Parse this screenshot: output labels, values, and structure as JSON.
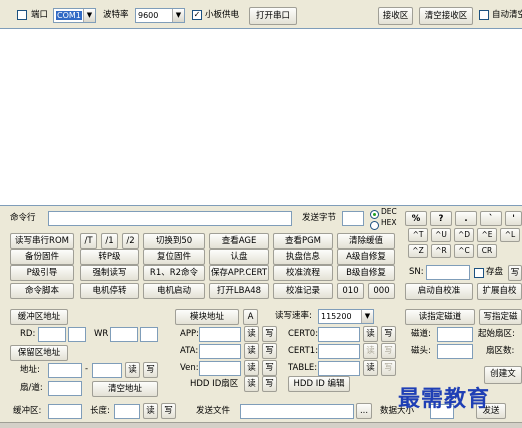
{
  "toolbar": {
    "port_label": "端口",
    "port_value": "COM1",
    "baud_label": "波特率",
    "baud_value": "9600",
    "board_power_label": "小板供电",
    "open_port_label": "打开串口",
    "recv_area_label": "接收区",
    "clear_recv_label": "清空接收区",
    "auto_clear_label": "自动清空"
  },
  "command": {
    "label": "命令行",
    "send_byte_label": "发送字节",
    "dec_label": "DEC",
    "hex_label": "HEX"
  },
  "keypad": {
    "row1": [
      "%",
      "?",
      ".",
      "`",
      "'"
    ],
    "row2": [
      "^T",
      "^U",
      "^D",
      "^E",
      "^L"
    ],
    "row3": [
      "^Z",
      "^R",
      "^C",
      "CR"
    ]
  },
  "grid": {
    "row1": [
      "读写串行ROM",
      "/T",
      "/1",
      "/2",
      "切换到50",
      "查看AGE",
      "查看PGM",
      "清除缓值"
    ],
    "row2": [
      "备份固件",
      "转P级",
      "复位固件",
      "认盘",
      "执盘信息",
      "A级自修复"
    ],
    "row3": [
      "P级引导",
      "强制读写",
      "R1、R2命令",
      "保存APP.CERT",
      "校准流程",
      "B级自修复"
    ],
    "row4": [
      "命令脚本",
      "电机停转",
      "电机启动",
      "打开LBA48",
      "校准记录",
      "010",
      "000"
    ]
  },
  "sn": {
    "label": "SN:",
    "save_label": "存盘",
    "write_label": "写"
  },
  "right_buttons": {
    "start_calib": "启动自校准",
    "expand": "扩展自校"
  },
  "buffer": {
    "buf_addr_label": "缓冲区地址",
    "rd_label": "RD:",
    "wr_label": "WR",
    "reserved_addr_label": "保留区地址",
    "addr_label": "地址:",
    "dash": "-",
    "read_label": "读",
    "write_label": "写",
    "sector_label": "扇/道:",
    "clear_addr_label": "清空地址",
    "buf_area_label": "缓冲区:",
    "length_label": "长度:"
  },
  "module": {
    "module_addr_label": "模块地址",
    "a_label": "A",
    "rw_rate_label": "读写速率:",
    "rw_rate_value": "115200",
    "app_label": "APP:",
    "ata_label": "ATA:",
    "ven_label": "Ven:",
    "hdd_id_sector_label": "HDD ID扇区",
    "cert0_label": "CERT0:",
    "cert1_label": "CERT1:",
    "table_label": "TABLE:",
    "hdd_id_edit_label": "HDD ID 编辑",
    "read_label": "读",
    "write_label": "写"
  },
  "bad_sector": {
    "read_label": "读指定磁道",
    "write_label": "写指定磁",
    "track_label": "磁道:",
    "head_label": "磁头:",
    "start_sector_label": "起始扇区:",
    "sector_count_label": "扇区数:",
    "create_label": "创建文"
  },
  "send": {
    "send_file_label": "发送文件",
    "ellipsis": "...",
    "data_size_label": "数据大小",
    "send_label": "发送"
  },
  "watermark": "最需教育"
}
